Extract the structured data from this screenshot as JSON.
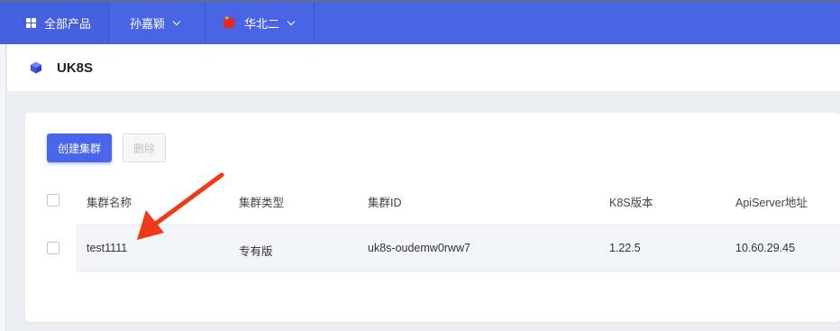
{
  "nav": {
    "all_products": "全部产品",
    "user": "孙嘉颖",
    "region": "华北二"
  },
  "page": {
    "title": "UK8S"
  },
  "toolbar": {
    "create_label": "创建集群",
    "delete_label": "删除"
  },
  "table": {
    "columns": [
      "集群名称",
      "集群类型",
      "集群ID",
      "K8S版本",
      "ApiServer地址"
    ],
    "rows": [
      [
        "test1111",
        "专有版",
        "uk8s-oudemw0rww7",
        "1.22.5",
        "10.60.29.45"
      ]
    ]
  },
  "colors": {
    "nav_bg": "#4a64e6",
    "accent": "#4966e8",
    "annotation_arrow": "#f03a17"
  }
}
